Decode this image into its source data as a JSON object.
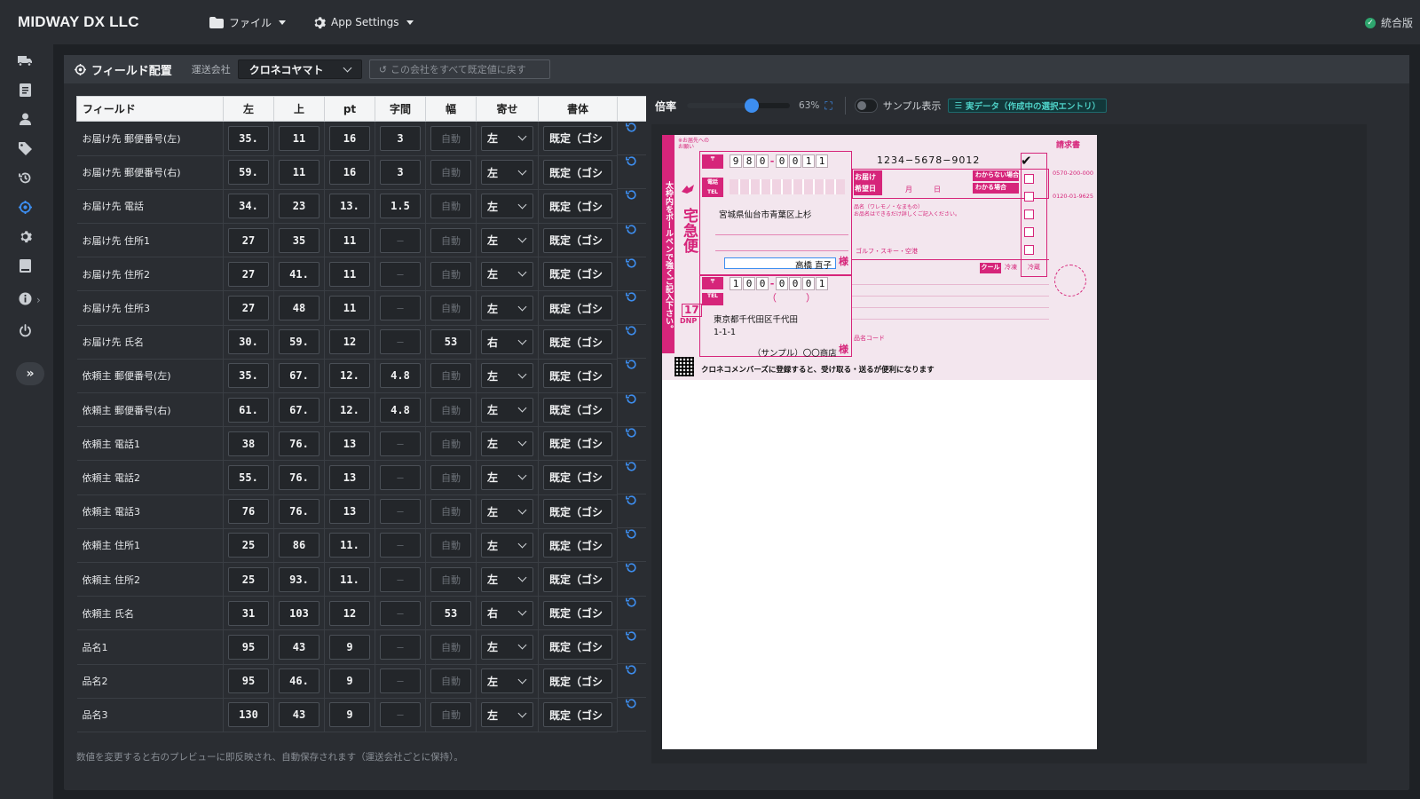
{
  "app": {
    "brand": "MIDWAY DX LLC",
    "menu_file": "ファイル",
    "menu_settings": "App Settings",
    "status_label": "統合版",
    "colors": {
      "accent": "#3d8ef0",
      "bg": "#1e2125",
      "panel": "#2a2d32",
      "status_ok": "#2ea56e",
      "label_pink": "#d6257a"
    }
  },
  "sidebar": {
    "icons": [
      "truck-icon",
      "document-icon",
      "user-icon",
      "tag-icon",
      "history-icon",
      "crosshair-icon",
      "gear-icon",
      "book-icon",
      "info-icon",
      "power-icon"
    ],
    "active": "crosshair-icon",
    "expand_glyph": "»"
  },
  "panel": {
    "title": "フィールド配置",
    "carrier_label": "運送会社",
    "carrier_value": "クロネコヤマト",
    "reset_label": "この会社をすべて既定値に戻す"
  },
  "table": {
    "headers": [
      "フィールド",
      "左",
      "上",
      "pt",
      "字間",
      "幅",
      "寄せ",
      "書体",
      ""
    ],
    "rows": [
      {
        "field": "お届け先 郵便番号(左)",
        "left": "35.",
        "top": "11",
        "pt": "16",
        "spacing": "3",
        "width": "自動",
        "align": "左",
        "font": "既定（ゴシ"
      },
      {
        "field": "お届け先 郵便番号(右)",
        "left": "59.",
        "top": "11",
        "pt": "16",
        "spacing": "3",
        "width": "自動",
        "align": "左",
        "font": "既定（ゴシ"
      },
      {
        "field": "お届け先 電話",
        "left": "34.",
        "top": "23",
        "pt": "13.",
        "spacing": "1.5",
        "width": "自動",
        "align": "左",
        "font": "既定（ゴシ"
      },
      {
        "field": "お届け先 住所1",
        "left": "27",
        "top": "35",
        "pt": "11",
        "spacing": "–",
        "width": "自動",
        "align": "左",
        "font": "既定（ゴシ"
      },
      {
        "field": "お届け先 住所2",
        "left": "27",
        "top": "41.",
        "pt": "11",
        "spacing": "–",
        "width": "自動",
        "align": "左",
        "font": "既定（ゴシ"
      },
      {
        "field": "お届け先 住所3",
        "left": "27",
        "top": "48",
        "pt": "11",
        "spacing": "–",
        "width": "自動",
        "align": "左",
        "font": "既定（ゴシ"
      },
      {
        "field": "お届け先 氏名",
        "left": "30.",
        "top": "59.",
        "pt": "12",
        "spacing": "–",
        "width": "53",
        "align": "右",
        "font": "既定（ゴシ"
      },
      {
        "field": "依頼主 郵便番号(左)",
        "left": "35.",
        "top": "67.",
        "pt": "12.",
        "spacing": "4.8",
        "width": "自動",
        "align": "左",
        "font": "既定（ゴシ"
      },
      {
        "field": "依頼主 郵便番号(右)",
        "left": "61.",
        "top": "67.",
        "pt": "12.",
        "spacing": "4.8",
        "width": "自動",
        "align": "左",
        "font": "既定（ゴシ"
      },
      {
        "field": "依頼主 電話1",
        "left": "38",
        "top": "76.",
        "pt": "13",
        "spacing": "–",
        "width": "自動",
        "align": "左",
        "font": "既定（ゴシ"
      },
      {
        "field": "依頼主 電話2",
        "left": "55.",
        "top": "76.",
        "pt": "13",
        "spacing": "–",
        "width": "自動",
        "align": "左",
        "font": "既定（ゴシ"
      },
      {
        "field": "依頼主 電話3",
        "left": "76",
        "top": "76.",
        "pt": "13",
        "spacing": "–",
        "width": "自動",
        "align": "左",
        "font": "既定（ゴシ"
      },
      {
        "field": "依頼主 住所1",
        "left": "25",
        "top": "86",
        "pt": "11.",
        "spacing": "–",
        "width": "自動",
        "align": "左",
        "font": "既定（ゴシ"
      },
      {
        "field": "依頼主 住所2",
        "left": "25",
        "top": "93.",
        "pt": "11.",
        "spacing": "–",
        "width": "自動",
        "align": "左",
        "font": "既定（ゴシ"
      },
      {
        "field": "依頼主 氏名",
        "left": "31",
        "top": "103",
        "pt": "12",
        "spacing": "–",
        "width": "53",
        "align": "右",
        "font": "既定（ゴシ"
      },
      {
        "field": "品名1",
        "left": "95",
        "top": "43",
        "pt": "9",
        "spacing": "–",
        "width": "自動",
        "align": "左",
        "font": "既定（ゴシ"
      },
      {
        "field": "品名2",
        "left": "95",
        "top": "46.",
        "pt": "9",
        "spacing": "–",
        "width": "自動",
        "align": "左",
        "font": "既定（ゴシ"
      },
      {
        "field": "品名3",
        "left": "130",
        "top": "43",
        "pt": "9",
        "spacing": "–",
        "width": "自動",
        "align": "左",
        "font": "既定（ゴシ"
      }
    ],
    "footnote": "数値を変更すると右のプレビューに即反映され、自動保存されます（運送会社ごとに保持）。"
  },
  "preview": {
    "zoom_label": "倍率",
    "zoom_percent": "63%",
    "zoom_value": 0.63,
    "sample_toggle_label": "サンプル表示",
    "sample_toggle_on": false,
    "data_badge": "実データ（作成中の選択エントリ）",
    "label": {
      "recipient_postal": [
        "9",
        "8",
        "0",
        "-",
        "0",
        "0",
        "1",
        "1"
      ],
      "tracking_no": "1234−5678−9012",
      "recipient_address": "宮城県仙台市青葉区上杉",
      "recipient_name": "高橋 直子",
      "honorific": "様",
      "sender_postal": [
        "1",
        "0",
        "0",
        "-",
        "0",
        "0",
        "0",
        "1"
      ],
      "sender_tel_placeholder": "（　　　）",
      "sender_address1": "東京都千代田区千代田",
      "sender_address2": "1-1-1",
      "sender_name": "（サンプル）〇〇商店",
      "vertical_note": "太枠内をボールペンで強くご記入下さい。",
      "brand_vertical": "宅急便",
      "delivery_date_label": "お届け希望日",
      "month_label": "月",
      "day_label": "日",
      "unknown_label": "わからない場合",
      "known_label": "わかる場合",
      "golf_label": "ゴルフ・スキー・空港",
      "cool_label": "クール",
      "cool_options": [
        "冷凍",
        "冷蔵"
      ],
      "member_note": "クロネコメンバーズに登録すると、受け取る・送るが便利になります",
      "dnp_label": "DNP",
      "invoice_label": "請求書",
      "phone1": "0570-200-000",
      "phone2": "0120-01-9625"
    }
  }
}
